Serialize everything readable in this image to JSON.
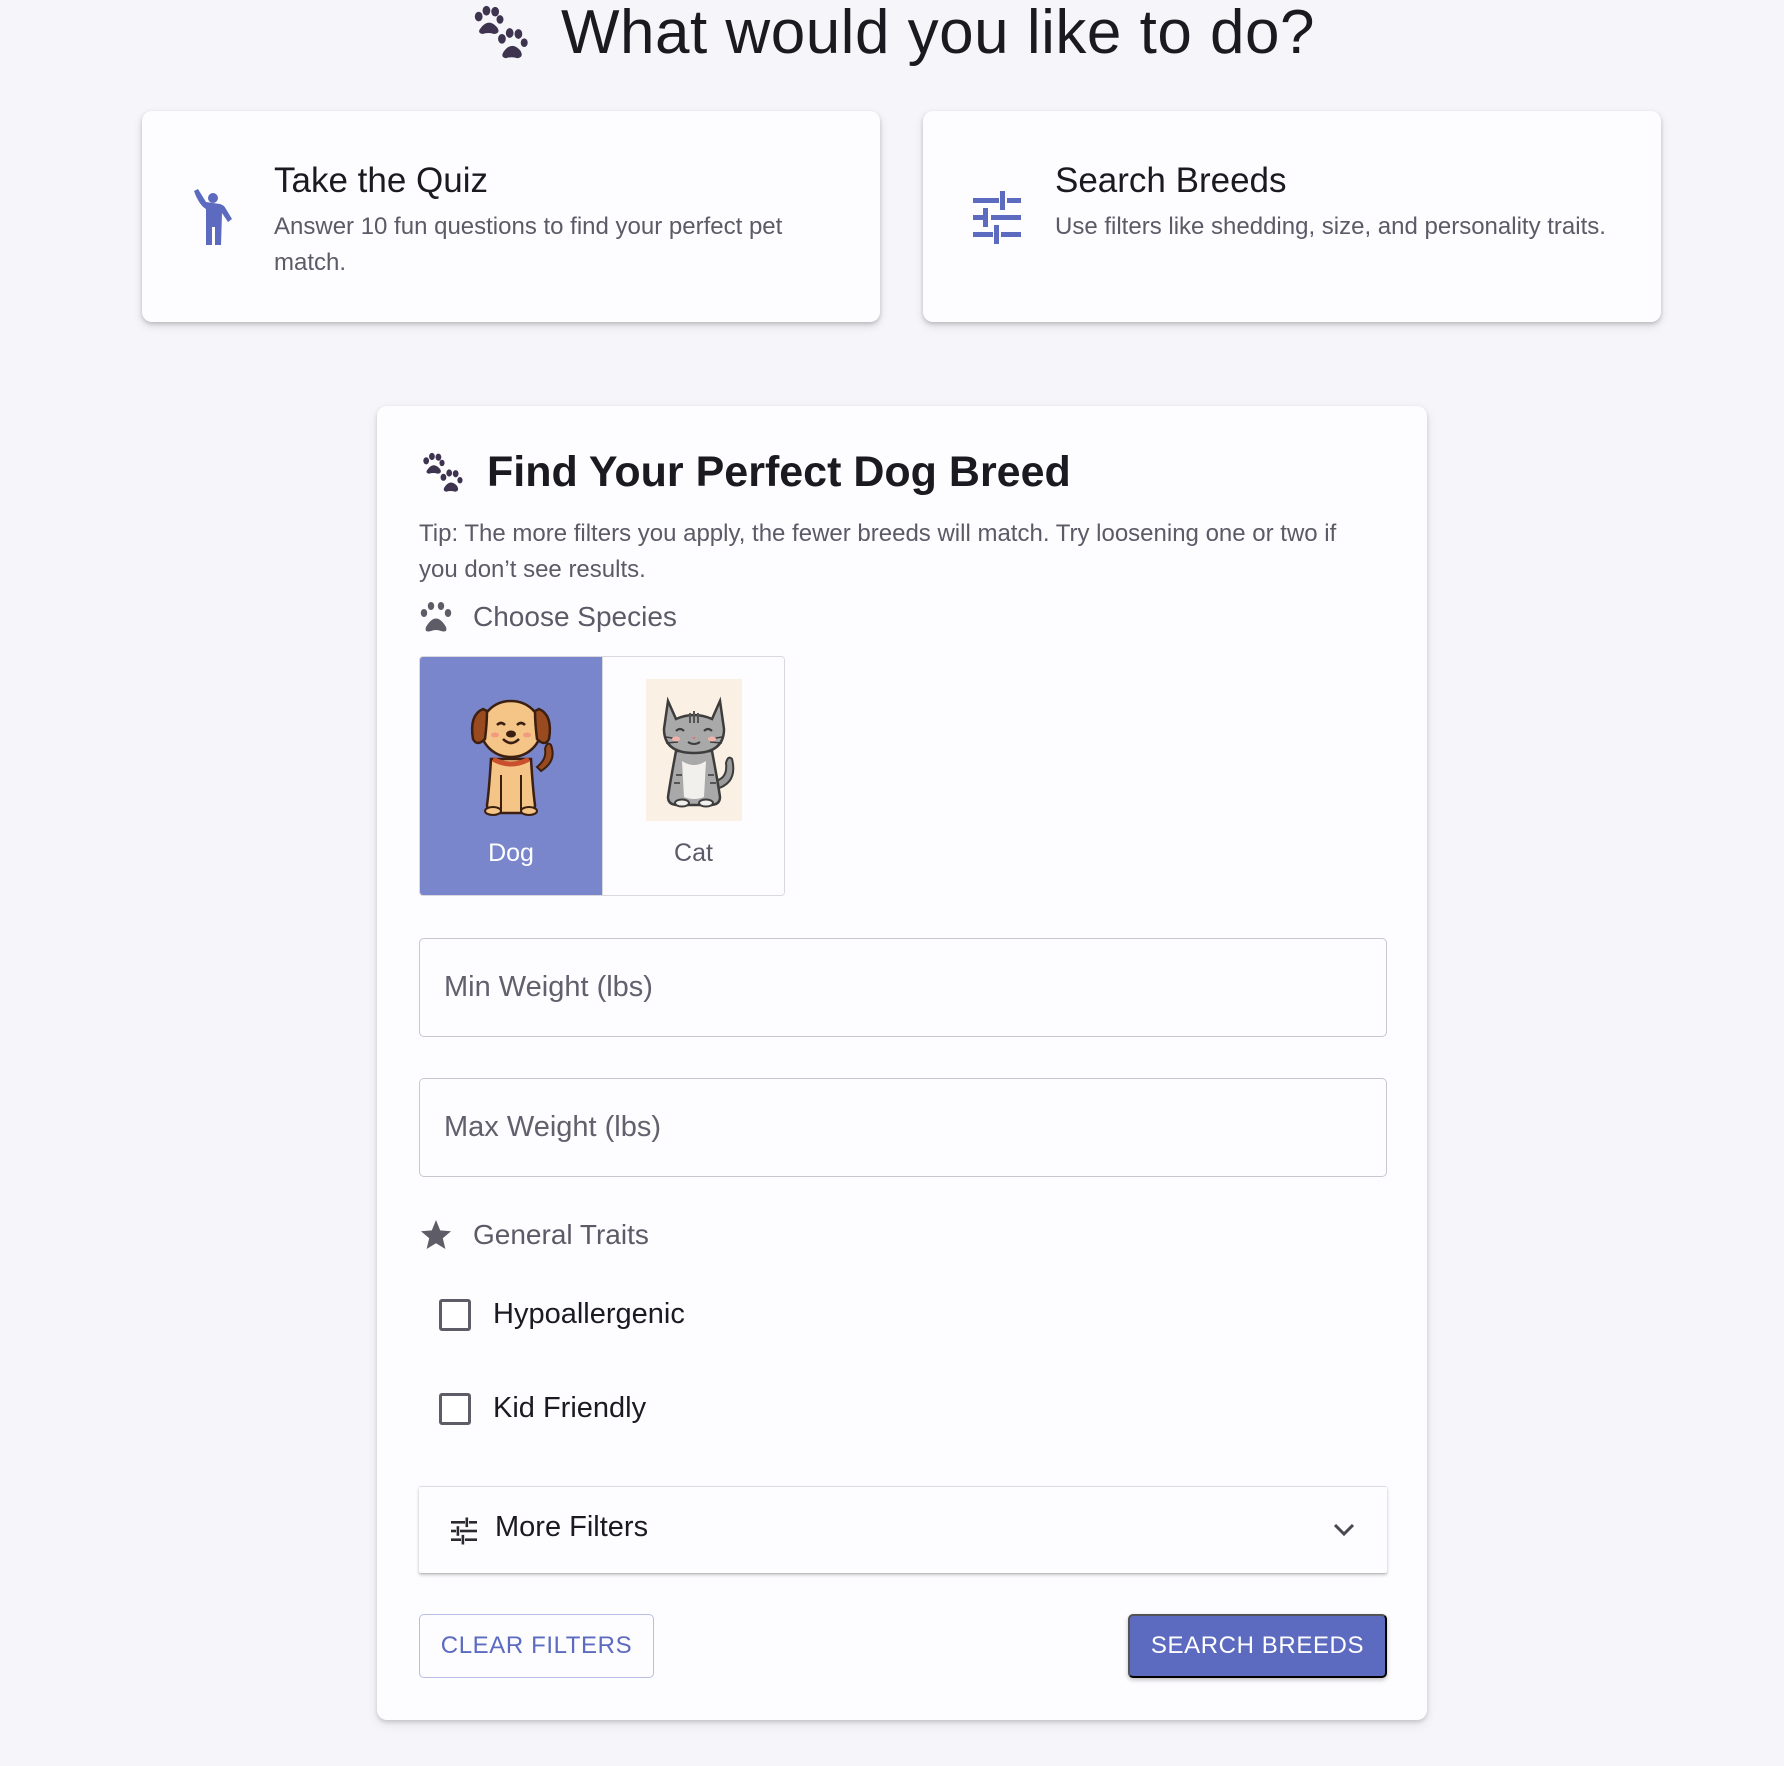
{
  "header": {
    "title": "What would you like to do?",
    "icon": "paw-icon"
  },
  "options": [
    {
      "title": "Take the Quiz",
      "description": "Answer 10 fun questions to find your perfect pet match.",
      "icon": "person-raising-hand-icon"
    },
    {
      "title": "Search Breeds",
      "description": "Use filters like shedding, size, and personality traits.",
      "icon": "tune-icon"
    }
  ],
  "panel": {
    "title": "Find Your Perfect Dog Breed",
    "tip": "Tip: The more filters you apply, the fewer breeds will match. Try loosening one or two if you don’t see results.",
    "species_label": "Choose Species",
    "species": [
      {
        "name": "Dog",
        "selected": true,
        "icon": "dog-icon"
      },
      {
        "name": "Cat",
        "selected": false,
        "icon": "cat-icon"
      }
    ],
    "min_weight": {
      "placeholder": "Min Weight (lbs)",
      "value": ""
    },
    "max_weight": {
      "placeholder": "Max Weight (lbs)",
      "value": ""
    },
    "traits_label": "General Traits",
    "traits": [
      {
        "label": "Hypoallergenic",
        "checked": false
      },
      {
        "label": "Kid Friendly",
        "checked": false
      }
    ],
    "more_filters_label": "More Filters",
    "clear_button": "CLEAR FILTERS",
    "search_button": "SEARCH BREEDS"
  },
  "colors": {
    "primary": "#5c6bc0",
    "selected_species": "#7986cb",
    "background": "#f6f6fa",
    "paw": "#3e3450"
  }
}
